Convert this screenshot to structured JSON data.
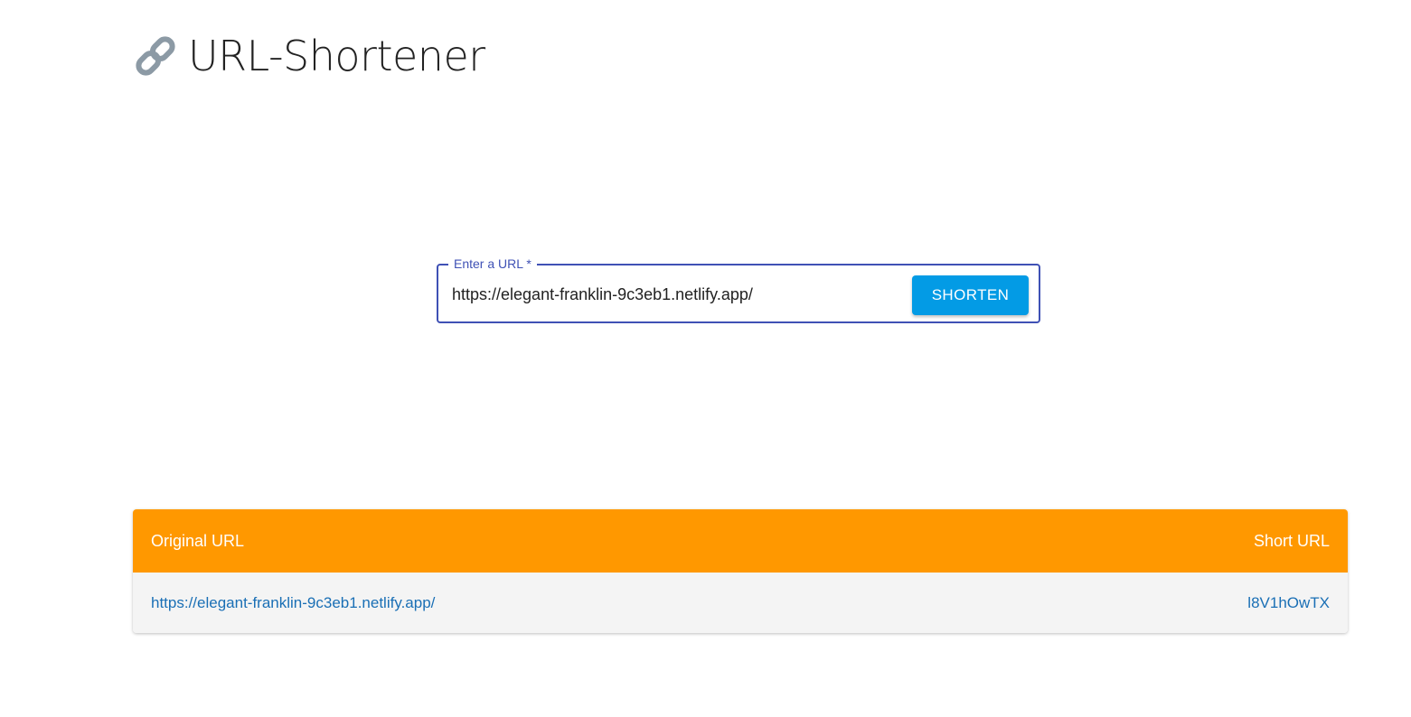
{
  "header": {
    "icon": "link-icon",
    "title": "URL-Shortener"
  },
  "form": {
    "label": "Enter a URL *",
    "value": "https://elegant-franklin-9c3eb1.netlify.app/",
    "button_label": "SHORTEN"
  },
  "table": {
    "columns": [
      "Original URL",
      "Short URL"
    ],
    "rows": [
      {
        "original": "https://elegant-franklin-9c3eb1.netlify.app/",
        "short": "l8V1hOwTX"
      }
    ]
  },
  "colors": {
    "accent": "#3f51b5",
    "button": "#039be5",
    "table_header": "#ff9800",
    "link": "#1a6fb5"
  }
}
